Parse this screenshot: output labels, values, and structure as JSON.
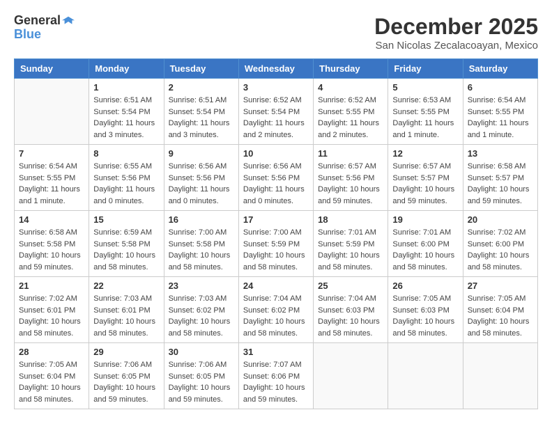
{
  "header": {
    "logo_general": "General",
    "logo_blue": "Blue",
    "month": "December 2025",
    "location": "San Nicolas Zecalacoayan, Mexico"
  },
  "weekdays": [
    "Sunday",
    "Monday",
    "Tuesday",
    "Wednesday",
    "Thursday",
    "Friday",
    "Saturday"
  ],
  "weeks": [
    [
      {
        "day": "",
        "content": ""
      },
      {
        "day": "1",
        "content": "Sunrise: 6:51 AM\nSunset: 5:54 PM\nDaylight: 11 hours\nand 3 minutes."
      },
      {
        "day": "2",
        "content": "Sunrise: 6:51 AM\nSunset: 5:54 PM\nDaylight: 11 hours\nand 3 minutes."
      },
      {
        "day": "3",
        "content": "Sunrise: 6:52 AM\nSunset: 5:54 PM\nDaylight: 11 hours\nand 2 minutes."
      },
      {
        "day": "4",
        "content": "Sunrise: 6:52 AM\nSunset: 5:55 PM\nDaylight: 11 hours\nand 2 minutes."
      },
      {
        "day": "5",
        "content": "Sunrise: 6:53 AM\nSunset: 5:55 PM\nDaylight: 11 hours\nand 1 minute."
      },
      {
        "day": "6",
        "content": "Sunrise: 6:54 AM\nSunset: 5:55 PM\nDaylight: 11 hours\nand 1 minute."
      }
    ],
    [
      {
        "day": "7",
        "content": "Sunrise: 6:54 AM\nSunset: 5:55 PM\nDaylight: 11 hours\nand 1 minute."
      },
      {
        "day": "8",
        "content": "Sunrise: 6:55 AM\nSunset: 5:56 PM\nDaylight: 11 hours\nand 0 minutes."
      },
      {
        "day": "9",
        "content": "Sunrise: 6:56 AM\nSunset: 5:56 PM\nDaylight: 11 hours\nand 0 minutes."
      },
      {
        "day": "10",
        "content": "Sunrise: 6:56 AM\nSunset: 5:56 PM\nDaylight: 11 hours\nand 0 minutes."
      },
      {
        "day": "11",
        "content": "Sunrise: 6:57 AM\nSunset: 5:56 PM\nDaylight: 10 hours\nand 59 minutes."
      },
      {
        "day": "12",
        "content": "Sunrise: 6:57 AM\nSunset: 5:57 PM\nDaylight: 10 hours\nand 59 minutes."
      },
      {
        "day": "13",
        "content": "Sunrise: 6:58 AM\nSunset: 5:57 PM\nDaylight: 10 hours\nand 59 minutes."
      }
    ],
    [
      {
        "day": "14",
        "content": "Sunrise: 6:58 AM\nSunset: 5:58 PM\nDaylight: 10 hours\nand 59 minutes."
      },
      {
        "day": "15",
        "content": "Sunrise: 6:59 AM\nSunset: 5:58 PM\nDaylight: 10 hours\nand 58 minutes."
      },
      {
        "day": "16",
        "content": "Sunrise: 7:00 AM\nSunset: 5:58 PM\nDaylight: 10 hours\nand 58 minutes."
      },
      {
        "day": "17",
        "content": "Sunrise: 7:00 AM\nSunset: 5:59 PM\nDaylight: 10 hours\nand 58 minutes."
      },
      {
        "day": "18",
        "content": "Sunrise: 7:01 AM\nSunset: 5:59 PM\nDaylight: 10 hours\nand 58 minutes."
      },
      {
        "day": "19",
        "content": "Sunrise: 7:01 AM\nSunset: 6:00 PM\nDaylight: 10 hours\nand 58 minutes."
      },
      {
        "day": "20",
        "content": "Sunrise: 7:02 AM\nSunset: 6:00 PM\nDaylight: 10 hours\nand 58 minutes."
      }
    ],
    [
      {
        "day": "21",
        "content": "Sunrise: 7:02 AM\nSunset: 6:01 PM\nDaylight: 10 hours\nand 58 minutes."
      },
      {
        "day": "22",
        "content": "Sunrise: 7:03 AM\nSunset: 6:01 PM\nDaylight: 10 hours\nand 58 minutes."
      },
      {
        "day": "23",
        "content": "Sunrise: 7:03 AM\nSunset: 6:02 PM\nDaylight: 10 hours\nand 58 minutes."
      },
      {
        "day": "24",
        "content": "Sunrise: 7:04 AM\nSunset: 6:02 PM\nDaylight: 10 hours\nand 58 minutes."
      },
      {
        "day": "25",
        "content": "Sunrise: 7:04 AM\nSunset: 6:03 PM\nDaylight: 10 hours\nand 58 minutes."
      },
      {
        "day": "26",
        "content": "Sunrise: 7:05 AM\nSunset: 6:03 PM\nDaylight: 10 hours\nand 58 minutes."
      },
      {
        "day": "27",
        "content": "Sunrise: 7:05 AM\nSunset: 6:04 PM\nDaylight: 10 hours\nand 58 minutes."
      }
    ],
    [
      {
        "day": "28",
        "content": "Sunrise: 7:05 AM\nSunset: 6:04 PM\nDaylight: 10 hours\nand 58 minutes."
      },
      {
        "day": "29",
        "content": "Sunrise: 7:06 AM\nSunset: 6:05 PM\nDaylight: 10 hours\nand 59 minutes."
      },
      {
        "day": "30",
        "content": "Sunrise: 7:06 AM\nSunset: 6:05 PM\nDaylight: 10 hours\nand 59 minutes."
      },
      {
        "day": "31",
        "content": "Sunrise: 7:07 AM\nSunset: 6:06 PM\nDaylight: 10 hours\nand 59 minutes."
      },
      {
        "day": "",
        "content": ""
      },
      {
        "day": "",
        "content": ""
      },
      {
        "day": "",
        "content": ""
      }
    ]
  ]
}
